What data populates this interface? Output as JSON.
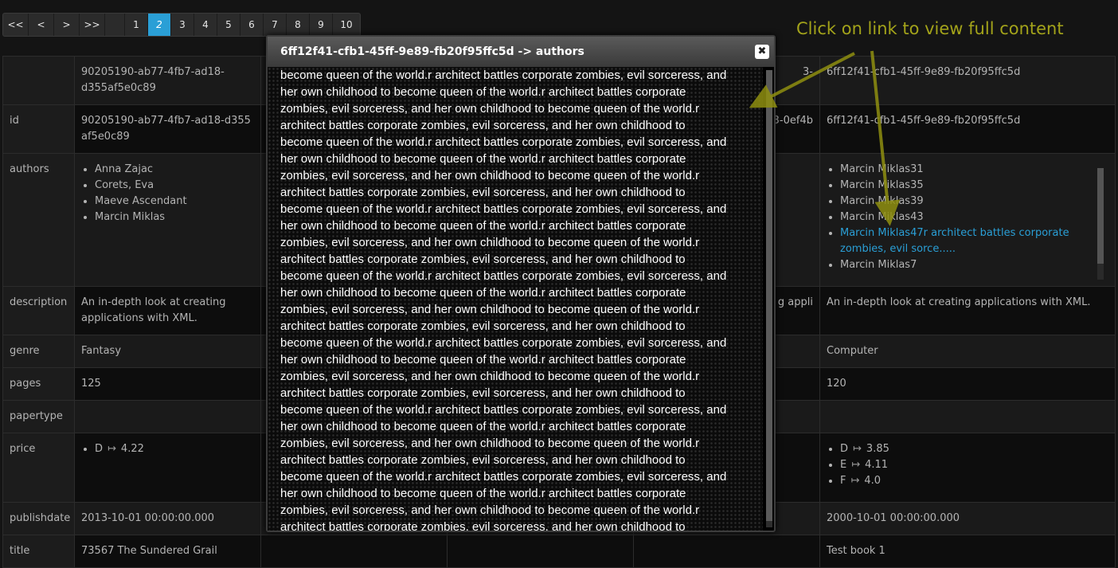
{
  "pagination": {
    "first": "<<",
    "prev": "<",
    "next": ">",
    "last": ">>",
    "pages": [
      "1",
      "2",
      "3",
      "4",
      "5",
      "6",
      "7",
      "8",
      "9",
      "10"
    ],
    "current": "2"
  },
  "table": {
    "row_header": {
      "col1": "90205190-ab77-4fb7-ad18-d355af5e0c89",
      "col2": "",
      "col3": "",
      "col4": "3-",
      "col5": "6ff12f41-cfb1-45ff-9e89-fb20f95ffc5d"
    },
    "id": {
      "key": "id",
      "col1": "90205190-ab77-4fb7-ad18-d355af5e0c89",
      "col4": "3-0ef4b",
      "col5": "6ff12f41-cfb1-45ff-9e89-fb20f95ffc5d"
    },
    "authors": {
      "key": "authors",
      "col1": [
        "Anna Zajac",
        "Corets, Eva",
        "Maeve Ascendant",
        "Marcin Miklas"
      ],
      "col5": [
        "Marcin Miklas31",
        "Marcin Miklas35",
        "Marcin Miklas39",
        "Marcin Miklas43"
      ],
      "col5_link": "Marcin Miklas47r architect battles corporate zombies, evil sorce.....",
      "col5_last": "Marcin Miklas7"
    },
    "description": {
      "key": "description",
      "col1": "An in-depth look at creating applications with XML.",
      "col4": "g appli",
      "col5": "An in-depth look at creating applications with XML."
    },
    "genre": {
      "key": "genre",
      "col1": "Fantasy",
      "col5": "Computer"
    },
    "pages": {
      "key": "pages",
      "col1": "125",
      "col5": "120"
    },
    "papertype": {
      "key": "papertype"
    },
    "price": {
      "key": "price",
      "col1": [
        {
          "k": "D",
          "v": "4.22"
        }
      ],
      "col5": [
        {
          "k": "D",
          "v": "3.85"
        },
        {
          "k": "E",
          "v": "4.11"
        },
        {
          "k": "F",
          "v": "4.0"
        }
      ],
      "arrow": "↦"
    },
    "publishdate": {
      "key": "publishdate",
      "col1": "2013-10-01 00:00:00.000",
      "col5": "2000-10-01 00:00:00.000"
    },
    "title": {
      "key": "title",
      "col1": "73567 The Sundered Grail",
      "col5": "Test book 1"
    }
  },
  "modal": {
    "title": "6ff12f41-cfb1-45ff-9e89-fb20f95ffc5d -> authors",
    "close": "✖",
    "body_lines": [
      "become queen of the world.r architect battles corporate zombies, evil sorceress, and",
      "her own childhood to become queen of the world.r architect battles corporate",
      "zombies, evil sorceress, and her own childhood to become queen of the world.r",
      "architect battles corporate zombies, evil sorceress, and her own childhood to",
      "become queen of the world.r architect battles corporate zombies, evil sorceress, and",
      "her own childhood to become queen of the world.r architect battles corporate",
      "zombies, evil sorceress, and her own childhood to become queen of the world.r",
      "architect battles corporate zombies, evil sorceress, and her own childhood to",
      "become queen of the world.r architect battles corporate zombies, evil sorceress, and",
      "her own childhood to become queen of the world.r architect battles corporate",
      "zombies, evil sorceress, and her own childhood to become queen of the world.r",
      "architect battles corporate zombies, evil sorceress, and her own childhood to",
      "become queen of the world.r architect battles corporate zombies, evil sorceress, and",
      "her own childhood to become queen of the world.r architect battles corporate",
      "zombies, evil sorceress, and her own childhood to become queen of the world.r",
      "architect battles corporate zombies, evil sorceress, and her own childhood to",
      "become queen of the world.r architect battles corporate zombies, evil sorceress, and",
      "her own childhood to become queen of the world.r architect battles corporate",
      "zombies, evil sorceress, and her own childhood to become queen of the world.r",
      "architect battles corporate zombies, evil sorceress, and her own childhood to",
      "become queen of the world.r architect battles corporate zombies, evil sorceress, and",
      "her own childhood to become queen of the world.r architect battles corporate",
      "zombies, evil sorceress, and her own childhood to become queen of the world.r",
      "architect battles corporate zombies, evil sorceress, and her own childhood to",
      "become queen of the world.r architect battles corporate zombies, evil sorceress, and",
      "her own childhood to become queen of the world.r architect battles corporate",
      "zombies, evil sorceress, and her own childhood to become queen of the world.r",
      "architect battles corporate zombies, evil sorceress, and her own childhood to"
    ]
  },
  "annotation": {
    "text": "Click on link to view full content",
    "color": "#a3a31a"
  }
}
